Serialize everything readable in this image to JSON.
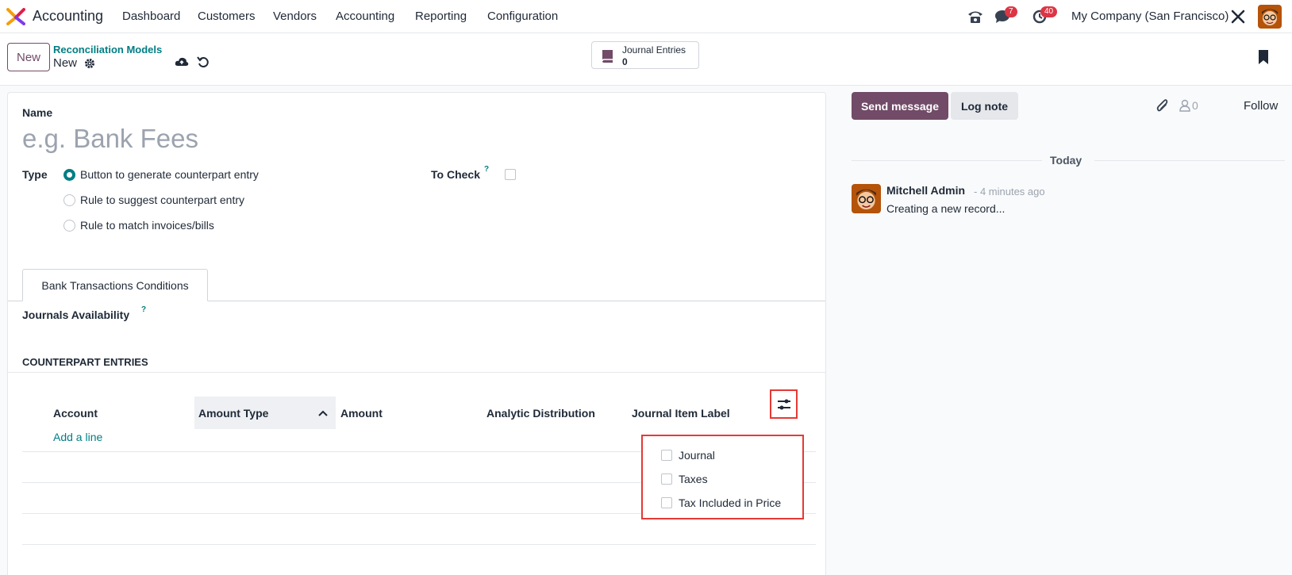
{
  "navbar": {
    "app_name": "Accounting",
    "menu": [
      "Dashboard",
      "Customers",
      "Vendors",
      "Accounting",
      "Reporting",
      "Configuration"
    ],
    "messages_badge": "7",
    "activities_badge": "40",
    "company": "My Company (San Francisco)"
  },
  "control": {
    "new_button": "New",
    "breadcrumb_parent": "Reconciliation Models",
    "breadcrumb_current": "New",
    "smart_button_label": "Journal Entries",
    "smart_button_count": "0"
  },
  "form": {
    "name_label": "Name",
    "name_placeholder": "e.g. Bank Fees",
    "type_label": "Type",
    "type_options": [
      "Button to generate counterpart entry",
      "Rule to suggest counterpart entry",
      "Rule to match invoices/bills"
    ],
    "to_check_label": "To Check",
    "help_mark": "?",
    "tab_label": "Bank Transactions Conditions",
    "journals_label": "Journals Availability",
    "counterpart_title": "COUNTERPART ENTRIES",
    "columns": [
      "Account",
      "Amount Type",
      "Amount",
      "Analytic Distribution",
      "Journal Item Label"
    ],
    "add_line": "Add a line",
    "optional_columns": [
      "Journal",
      "Taxes",
      "Tax Included in Price"
    ]
  },
  "chatter": {
    "send_message": "Send message",
    "log_note": "Log note",
    "followers_count": "0",
    "follow": "Follow",
    "date_separator": "Today",
    "author": "Mitchell Admin",
    "time": "- 4 minutes ago",
    "message": "Creating a new record..."
  },
  "colors": {
    "brand": "#714b67",
    "teal": "#017e84",
    "highlight": "#e53935"
  }
}
